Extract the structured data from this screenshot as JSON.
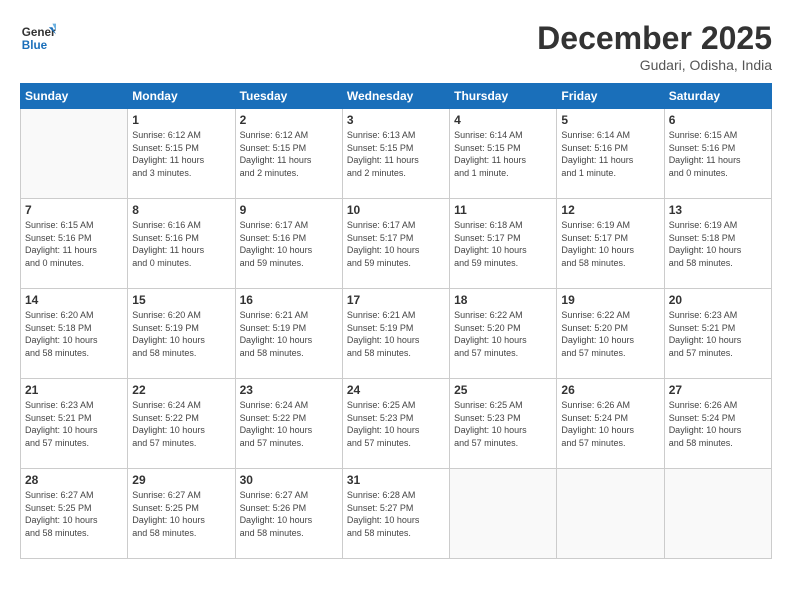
{
  "header": {
    "logo_line1": "General",
    "logo_line2": "Blue",
    "month": "December 2025",
    "location": "Gudari, Odisha, India"
  },
  "days_of_week": [
    "Sunday",
    "Monday",
    "Tuesday",
    "Wednesday",
    "Thursday",
    "Friday",
    "Saturday"
  ],
  "weeks": [
    [
      {
        "day": "",
        "info": ""
      },
      {
        "day": "1",
        "info": "Sunrise: 6:12 AM\nSunset: 5:15 PM\nDaylight: 11 hours\nand 3 minutes."
      },
      {
        "day": "2",
        "info": "Sunrise: 6:12 AM\nSunset: 5:15 PM\nDaylight: 11 hours\nand 2 minutes."
      },
      {
        "day": "3",
        "info": "Sunrise: 6:13 AM\nSunset: 5:15 PM\nDaylight: 11 hours\nand 2 minutes."
      },
      {
        "day": "4",
        "info": "Sunrise: 6:14 AM\nSunset: 5:15 PM\nDaylight: 11 hours\nand 1 minute."
      },
      {
        "day": "5",
        "info": "Sunrise: 6:14 AM\nSunset: 5:16 PM\nDaylight: 11 hours\nand 1 minute."
      },
      {
        "day": "6",
        "info": "Sunrise: 6:15 AM\nSunset: 5:16 PM\nDaylight: 11 hours\nand 0 minutes."
      }
    ],
    [
      {
        "day": "7",
        "info": "Sunrise: 6:15 AM\nSunset: 5:16 PM\nDaylight: 11 hours\nand 0 minutes."
      },
      {
        "day": "8",
        "info": "Sunrise: 6:16 AM\nSunset: 5:16 PM\nDaylight: 11 hours\nand 0 minutes."
      },
      {
        "day": "9",
        "info": "Sunrise: 6:17 AM\nSunset: 5:16 PM\nDaylight: 10 hours\nand 59 minutes."
      },
      {
        "day": "10",
        "info": "Sunrise: 6:17 AM\nSunset: 5:17 PM\nDaylight: 10 hours\nand 59 minutes."
      },
      {
        "day": "11",
        "info": "Sunrise: 6:18 AM\nSunset: 5:17 PM\nDaylight: 10 hours\nand 59 minutes."
      },
      {
        "day": "12",
        "info": "Sunrise: 6:19 AM\nSunset: 5:17 PM\nDaylight: 10 hours\nand 58 minutes."
      },
      {
        "day": "13",
        "info": "Sunrise: 6:19 AM\nSunset: 5:18 PM\nDaylight: 10 hours\nand 58 minutes."
      }
    ],
    [
      {
        "day": "14",
        "info": "Sunrise: 6:20 AM\nSunset: 5:18 PM\nDaylight: 10 hours\nand 58 minutes."
      },
      {
        "day": "15",
        "info": "Sunrise: 6:20 AM\nSunset: 5:19 PM\nDaylight: 10 hours\nand 58 minutes."
      },
      {
        "day": "16",
        "info": "Sunrise: 6:21 AM\nSunset: 5:19 PM\nDaylight: 10 hours\nand 58 minutes."
      },
      {
        "day": "17",
        "info": "Sunrise: 6:21 AM\nSunset: 5:19 PM\nDaylight: 10 hours\nand 58 minutes."
      },
      {
        "day": "18",
        "info": "Sunrise: 6:22 AM\nSunset: 5:20 PM\nDaylight: 10 hours\nand 57 minutes."
      },
      {
        "day": "19",
        "info": "Sunrise: 6:22 AM\nSunset: 5:20 PM\nDaylight: 10 hours\nand 57 minutes."
      },
      {
        "day": "20",
        "info": "Sunrise: 6:23 AM\nSunset: 5:21 PM\nDaylight: 10 hours\nand 57 minutes."
      }
    ],
    [
      {
        "day": "21",
        "info": "Sunrise: 6:23 AM\nSunset: 5:21 PM\nDaylight: 10 hours\nand 57 minutes."
      },
      {
        "day": "22",
        "info": "Sunrise: 6:24 AM\nSunset: 5:22 PM\nDaylight: 10 hours\nand 57 minutes."
      },
      {
        "day": "23",
        "info": "Sunrise: 6:24 AM\nSunset: 5:22 PM\nDaylight: 10 hours\nand 57 minutes."
      },
      {
        "day": "24",
        "info": "Sunrise: 6:25 AM\nSunset: 5:23 PM\nDaylight: 10 hours\nand 57 minutes."
      },
      {
        "day": "25",
        "info": "Sunrise: 6:25 AM\nSunset: 5:23 PM\nDaylight: 10 hours\nand 57 minutes."
      },
      {
        "day": "26",
        "info": "Sunrise: 6:26 AM\nSunset: 5:24 PM\nDaylight: 10 hours\nand 57 minutes."
      },
      {
        "day": "27",
        "info": "Sunrise: 6:26 AM\nSunset: 5:24 PM\nDaylight: 10 hours\nand 58 minutes."
      }
    ],
    [
      {
        "day": "28",
        "info": "Sunrise: 6:27 AM\nSunset: 5:25 PM\nDaylight: 10 hours\nand 58 minutes."
      },
      {
        "day": "29",
        "info": "Sunrise: 6:27 AM\nSunset: 5:25 PM\nDaylight: 10 hours\nand 58 minutes."
      },
      {
        "day": "30",
        "info": "Sunrise: 6:27 AM\nSunset: 5:26 PM\nDaylight: 10 hours\nand 58 minutes."
      },
      {
        "day": "31",
        "info": "Sunrise: 6:28 AM\nSunset: 5:27 PM\nDaylight: 10 hours\nand 58 minutes."
      },
      {
        "day": "",
        "info": ""
      },
      {
        "day": "",
        "info": ""
      },
      {
        "day": "",
        "info": ""
      }
    ]
  ]
}
